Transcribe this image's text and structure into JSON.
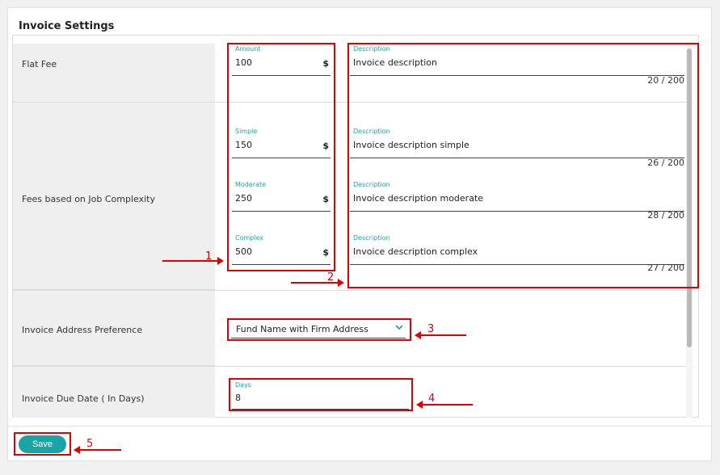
{
  "title": "Invoice Settings",
  "rows": {
    "flat_fee": {
      "label": "Flat Fee",
      "amount": {
        "label": "Amount",
        "value": "100",
        "currency": "$"
      },
      "description": {
        "label": "Description",
        "value": "Invoice description",
        "counter": "20 / 200"
      }
    },
    "complexity": {
      "label": "Fees based on Job Complexity",
      "simple": {
        "label": "Simple",
        "value": "150",
        "currency": "$"
      },
      "simple_desc": {
        "label": "Description",
        "value": "Invoice description simple",
        "counter": "26 / 200"
      },
      "moderate": {
        "label": "Moderate",
        "value": "250",
        "currency": "$"
      },
      "moderate_desc": {
        "label": "Description",
        "value": "Invoice description moderate",
        "counter": "28 / 200"
      },
      "complex": {
        "label": "Complex",
        "value": "500",
        "currency": "$"
      },
      "complex_desc": {
        "label": "Description",
        "value": "Invoice description complex",
        "counter": "27 / 200"
      }
    },
    "address": {
      "label": "Invoice Address Preference",
      "selected": "Fund Name with Firm Address",
      "chevron_icon": "chevron-down-icon"
    },
    "due_date": {
      "label": "Invoice Due Date ( In Days)",
      "days": {
        "label": "Days",
        "value": "8"
      }
    }
  },
  "save_label": "Save",
  "annotations": [
    "1",
    "2",
    "3",
    "4",
    "5"
  ],
  "colors": {
    "accent": "#1aa5a5",
    "annotation": "#e00000"
  }
}
